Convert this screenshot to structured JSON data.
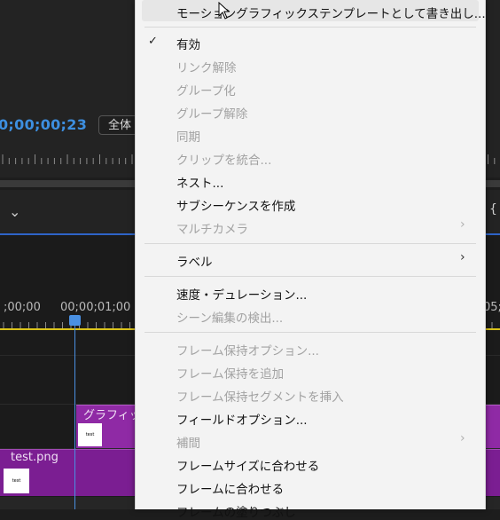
{
  "background": {
    "timecode": "0;00;00;23",
    "fit_select": "全体",
    "timeline_labels": [
      ";00;00",
      "00;00;01;00",
      "05;"
    ],
    "clips": {
      "graphic": {
        "label": "グラフィッ",
        "thumb": "test"
      },
      "png": {
        "label": "test.png",
        "thumb": "test"
      }
    },
    "chevron_icon": "chevron-down-icon"
  },
  "menu": {
    "items": [
      {
        "label": "モーショングラフィックステンプレートとして書き出し...",
        "enabled": true,
        "hovered": true
      },
      {
        "label": "有効",
        "enabled": true,
        "checked": true
      },
      {
        "label": "リンク解除",
        "enabled": false
      },
      {
        "label": "グループ化",
        "enabled": false
      },
      {
        "label": "グループ解除",
        "enabled": false
      },
      {
        "label": "同期",
        "enabled": false
      },
      {
        "label": "クリップを統合...",
        "enabled": false
      },
      {
        "label": "ネスト...",
        "enabled": true
      },
      {
        "label": "サブシーケンスを作成",
        "enabled": true
      },
      {
        "label": "マルチカメラ",
        "enabled": false,
        "submenu": true
      },
      {
        "label": "ラベル",
        "enabled": true,
        "submenu": true
      },
      {
        "label": "速度・デュレーション...",
        "enabled": true
      },
      {
        "label": "シーン編集の検出...",
        "enabled": false
      },
      {
        "label": "フレーム保持オプション...",
        "enabled": false
      },
      {
        "label": "フレーム保持を追加",
        "enabled": false
      },
      {
        "label": "フレーム保持セグメントを挿入",
        "enabled": false
      },
      {
        "label": "フィールドオプション...",
        "enabled": true
      },
      {
        "label": "補間",
        "enabled": false,
        "submenu": true
      },
      {
        "label": "フレームサイズに合わせる",
        "enabled": true
      },
      {
        "label": "フレームに合わせる",
        "enabled": true
      },
      {
        "label": "フレームの塗りつぶし",
        "enabled": true
      }
    ],
    "check_glyph": "✓",
    "submenu_glyph": "›"
  }
}
